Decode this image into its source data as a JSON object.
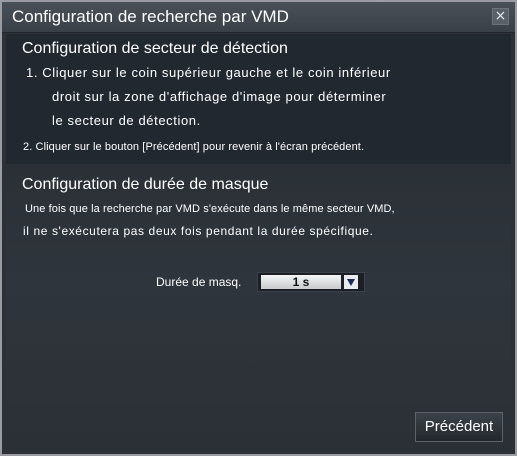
{
  "dialog": {
    "title": "Configuration de recherche par VMD",
    "close_label": "×",
    "accent_color": "#2c3138"
  },
  "detection_area": {
    "heading": "Configuration de secteur de détection",
    "step1_line1": "1. Cliquer sur le coin supérieur gauche et le coin inférieur",
    "step1_line2": "droit sur la zone d'affichage d'image pour déterminer",
    "step1_line3": "le secteur de détection.",
    "step2": "2. Cliquer sur le bouton [Précédent] pour revenir à l'écran précédent."
  },
  "mask_duration": {
    "heading": "Configuration de durée de masque",
    "desc_line1": "Une fois que la recherche par VMD s'exécute dans le même secteur VMD,",
    "desc_line2": "il ne s'exécutera pas deux fois pendant la durée spécifique.",
    "field_label": "Durée de masq.",
    "selected_value": "1 s",
    "arrow_icon": "triangle-down-icon"
  },
  "footer": {
    "back_label": "Précédent"
  }
}
